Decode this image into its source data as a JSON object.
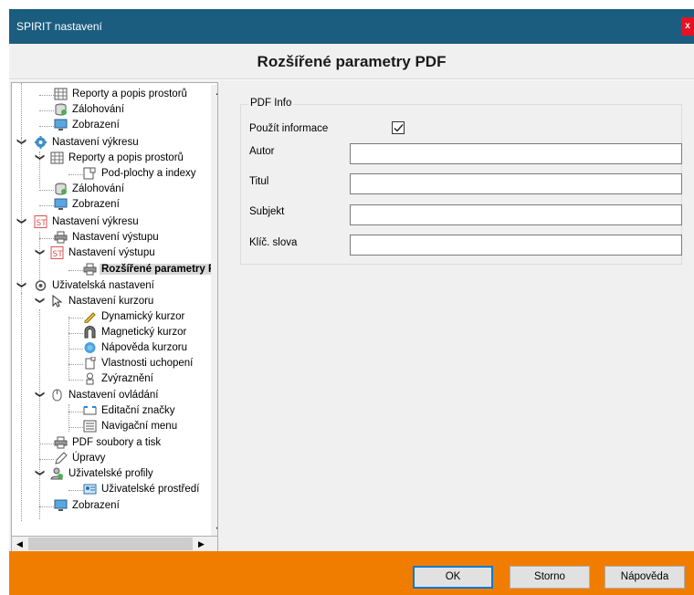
{
  "window": {
    "title": "SPIRIT nastavení",
    "close_glyph": "x"
  },
  "header": {
    "title": "Rozšířené parametry PDF"
  },
  "tree": {
    "items": [
      {
        "label": "Reporty a popis prostorů",
        "icon": "grid-report-icon"
      },
      {
        "label": "Zálohování",
        "icon": "database-icon"
      },
      {
        "label": "Zobrazení",
        "icon": "monitor-icon"
      },
      {
        "label": "Nastavení výkresu",
        "icon": "gear-icon"
      },
      {
        "label": "Reporty a popis prostorů",
        "icon": "grid-report-icon"
      },
      {
        "label": "Pod-plochy a indexy",
        "icon": "subarea-icon"
      },
      {
        "label": "Zálohování",
        "icon": "database-icon"
      },
      {
        "label": "Zobrazení",
        "icon": "monitor-icon"
      },
      {
        "label": "Nastavení výkresu",
        "icon": "st-icon"
      },
      {
        "label": "Nastavení výstupu",
        "icon": "printer-icon"
      },
      {
        "label": "Nastavení výstupu",
        "icon": "st-icon"
      },
      {
        "label": "Rozšířené parametry PDF",
        "icon": "printer-icon"
      },
      {
        "label": "Uživatelská nastavení",
        "icon": "settings-gear-icon"
      },
      {
        "label": "Nastavení kurzoru",
        "icon": "cursor-arrow-icon"
      },
      {
        "label": "Dynamický kurzor",
        "icon": "pencil-cursor-icon"
      },
      {
        "label": "Magnetický kurzor",
        "icon": "magnet-icon"
      },
      {
        "label": "Nápověda kurzoru",
        "icon": "help-bubble-icon"
      },
      {
        "label": "Vlastnosti uchopení",
        "icon": "snap-icon"
      },
      {
        "label": "Zvýraznění",
        "icon": "highlight-icon"
      },
      {
        "label": "Nastavení ovládání",
        "icon": "mouse-icon"
      },
      {
        "label": "Editační značky",
        "icon": "edit-marks-icon"
      },
      {
        "label": "Navigační menu",
        "icon": "menu-list-icon"
      },
      {
        "label": "PDF soubory a tisk",
        "icon": "printer-icon"
      },
      {
        "label": "Úpravy",
        "icon": "pen-icon"
      },
      {
        "label": "Uživatelské profily",
        "icon": "user-profile-icon"
      },
      {
        "label": "Uživatelské prostředí",
        "icon": "user-card-icon"
      },
      {
        "label": "Zobrazení",
        "icon": "monitor-icon"
      }
    ],
    "selected_index": 11
  },
  "pdf_info": {
    "group_label": "PDF Info",
    "use_info_label": "Použít informace",
    "use_info_checked": true,
    "author_label": "Autor",
    "author_value": "",
    "title_label": "Titul",
    "title_value": "",
    "subject_label": "Subjekt",
    "subject_value": "",
    "keywords_label": "Klíč. slova",
    "keywords_value": ""
  },
  "buttons": {
    "ok": "OK",
    "cancel": "Storno",
    "help": "Nápověda"
  },
  "colors": {
    "titlebar": "#1b5d7f",
    "bottom_bar": "#f07d00",
    "panel": "#f0f0f0"
  }
}
